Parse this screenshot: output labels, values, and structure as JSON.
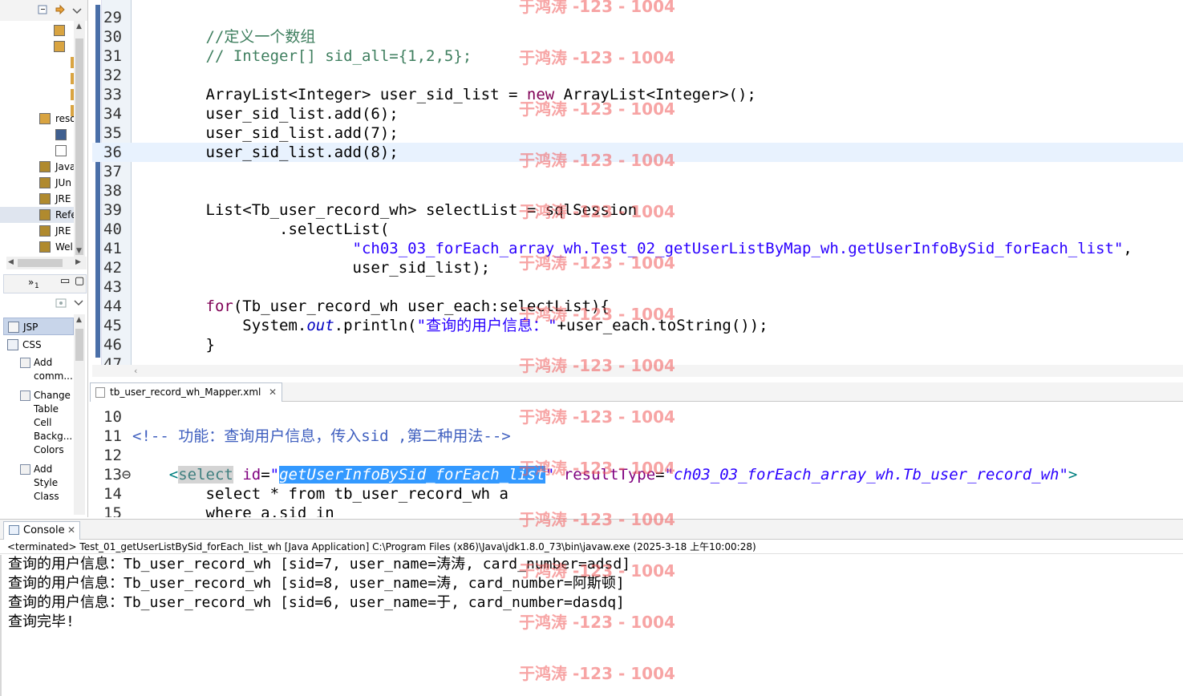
{
  "package_explorer": {
    "rows": [
      {
        "label": "",
        "icon": "grid-icon"
      },
      {
        "label": "",
        "icon": "package-icon"
      },
      {
        "label": "",
        "icon": "folder-icon"
      },
      {
        "label": "",
        "icon": "folder-icon"
      },
      {
        "label": "",
        "icon": "folder-icon"
      },
      {
        "label": "",
        "icon": "folder-icon"
      },
      {
        "label": "reso",
        "icon": "resource-folder-icon"
      },
      {
        "label": "",
        "icon": "table-icon"
      },
      {
        "label": "",
        "icon": "xml-file-icon"
      },
      {
        "label": "Java",
        "icon": "library-icon"
      },
      {
        "label": "JUn",
        "icon": "library-icon"
      },
      {
        "label": "JRE",
        "icon": "library-icon"
      },
      {
        "label": "Refe",
        "icon": "library-icon"
      },
      {
        "label": "JRE",
        "icon": "library-icon"
      },
      {
        "label": "Wel",
        "icon": "library-icon"
      }
    ]
  },
  "snippets": {
    "header_label": "»",
    "header_count": "1",
    "categories": [
      {
        "label": "JSP"
      },
      {
        "label": "CSS"
      }
    ],
    "items": [
      {
        "label": "Add comm..."
      },
      {
        "label": "Change Table Cell Backg... Colors"
      },
      {
        "label": "Add Style Class"
      }
    ]
  },
  "java_editor": {
    "lines": [
      {
        "no": "29",
        "html": ""
      },
      {
        "no": "30",
        "html": "        <span class=\"cm\">//定义一个数组</span>"
      },
      {
        "no": "31",
        "html": "        <span class=\"cm\">// Integer[] sid_all={1,2,5};</span>"
      },
      {
        "no": "32",
        "html": ""
      },
      {
        "no": "33",
        "html": "        ArrayList&lt;Integer&gt; user_sid_list = <span class=\"kw\">new</span> ArrayList&lt;Integer&gt;();"
      },
      {
        "no": "34",
        "html": "        user_sid_list.add(6);"
      },
      {
        "no": "35",
        "html": "        user_sid_list.add(7);"
      },
      {
        "no": "36",
        "html": "        user_sid_list.add(8);",
        "current": true
      },
      {
        "no": "37",
        "html": ""
      },
      {
        "no": "38",
        "html": ""
      },
      {
        "no": "39",
        "html": "        List&lt;Tb_user_record_wh&gt; selectList = sqlSession"
      },
      {
        "no": "40",
        "html": "                .selectList("
      },
      {
        "no": "41",
        "html": "                        <span class=\"str\">\"ch03_03_forEach_array_wh.Test_02_getUserListByMap_wh.getUserInfoBySid_forEach_list\"</span>,"
      },
      {
        "no": "42",
        "html": "                        user_sid_list);"
      },
      {
        "no": "43",
        "html": ""
      },
      {
        "no": "44",
        "html": "        <span class=\"kw\">for</span>(Tb_user_record_wh user_each:selectList){"
      },
      {
        "no": "45",
        "html": "            System.<span class=\"fld\">out</span>.println(<span class=\"str\">\"查询的用户信息：\"</span>+user_each.toString());"
      },
      {
        "no": "46",
        "html": "        }"
      },
      {
        "no": "47",
        "html": ""
      }
    ]
  },
  "xml_editor": {
    "tab_label": "tb_user_record_wh_Mapper.xml",
    "lines": [
      {
        "no": "10",
        "html": ""
      },
      {
        "no": "11",
        "html": "<span class=\"xcm\">&lt;!-- 功能：查询用户信息，传入sid ,第二种用法--&gt;</span>"
      },
      {
        "no": "12",
        "html": ""
      },
      {
        "no": "13⊖",
        "html": "    <span class=\"xtag\">&lt;</span><span class=\"xel xsel-el\">select</span> <span class=\"xattr\">id</span>=<span class=\"xval\">\"<span class=\"xsel\">getUserInfoBySid_forEach_list</span>\"</span> <span class=\"xattr\">resultType</span>=<span class=\"xval\">\"ch03_03_forEach_array_wh.Tb_user_record_wh\"</span><span class=\"xtag\">&gt;</span>"
      },
      {
        "no": "14",
        "html": "        select * from tb_user_record_wh a"
      },
      {
        "no": "15",
        "html": "        where a.sid in"
      }
    ]
  },
  "console": {
    "tab_label": "Console",
    "status": "<terminated> Test_01_getUserListBySid_forEach_list_wh [Java Application] C:\\Program Files (x86)\\Java\\jdk1.8.0_73\\bin\\javaw.exe (2025-3-18 上午10:00:28)",
    "output": [
      "查询的用户信息：Tb_user_record_wh [sid=7, user_name=涛涛, card_number=adsd]",
      "查询的用户信息：Tb_user_record_wh [sid=8, user_name=涛, card_number=阿斯顿]",
      "查询的用户信息：Tb_user_record_wh [sid=6, user_name=于, card_number=dasdq]",
      "查询完毕!"
    ]
  },
  "watermark": {
    "text": "于鸿涛 -123 - 1004",
    "color": "#f05a5a"
  },
  "colors": {
    "keyword": "#7f0055",
    "comment": "#3f7f5f",
    "string": "#2a00ff",
    "selection": "#3399ff",
    "current_line": "#e8f2fe"
  }
}
